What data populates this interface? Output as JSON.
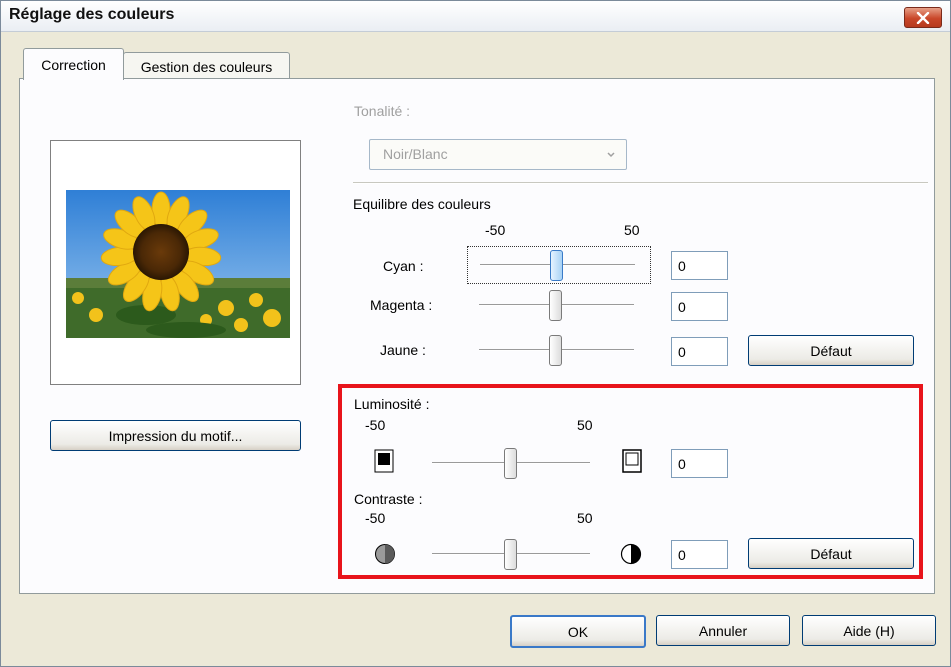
{
  "window": {
    "title": "Réglage des couleurs"
  },
  "tabs": [
    {
      "label": "Correction",
      "active": true
    },
    {
      "label": "Gestion des couleurs",
      "active": false
    }
  ],
  "preview": {
    "print_pattern_button": "Impression du motif..."
  },
  "tonalite": {
    "label": "Tonalité :",
    "value": "Noir/Blanc",
    "enabled": false
  },
  "color_balance": {
    "title": "Equilibre des couleurs",
    "scale_min": "-50",
    "scale_max": "50",
    "sliders": [
      {
        "label": "Cyan :",
        "value": "0",
        "level": 0,
        "focused": true
      },
      {
        "label": "Magenta :",
        "value": "0",
        "level": 0,
        "focused": false
      },
      {
        "label": "Jaune :",
        "value": "0",
        "level": 0,
        "focused": false
      }
    ],
    "default_button": "Défaut"
  },
  "brightness": {
    "title": "Luminosité :",
    "scale_min": "-50",
    "scale_max": "50",
    "value": "0",
    "level": 0,
    "low_icon": "dark-square-icon",
    "high_icon": "light-square-icon"
  },
  "contrast": {
    "title": "Contraste :",
    "scale_min": "-50",
    "scale_max": "50",
    "value": "0",
    "level": 0,
    "low_icon": "low-contrast-circle-icon",
    "high_icon": "high-contrast-circle-icon",
    "default_button": "Défaut"
  },
  "footer": {
    "ok": "OK",
    "cancel": "Annuler",
    "help": "Aide (H)"
  },
  "colors": {
    "highlight": "#e8141b",
    "focus_thumb": "#a8d2f5",
    "close_button": "#c9472a"
  }
}
